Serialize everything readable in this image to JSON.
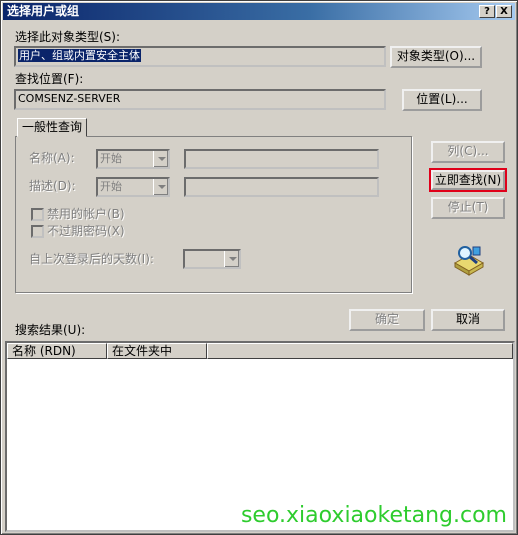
{
  "window": {
    "title": "选择用户或组",
    "help_button": "?",
    "close_button": "X"
  },
  "object_type": {
    "label": "选择此对象类型(S):",
    "value": "用户、组或内置安全主体",
    "button": "对象类型(O)..."
  },
  "location": {
    "label": "查找位置(F):",
    "value": "COMSENZ-SERVER",
    "button": "位置(L)..."
  },
  "query": {
    "tab_label": "一般性查询",
    "name_label": "名称(A):",
    "name_mode": "开始",
    "desc_label": "描述(D):",
    "desc_mode": "开始",
    "disabled_accounts": "禁用的帐户(B)",
    "non_expiring_pw": "不过期密码(X)",
    "days_label": "自上次登录后的天数(I):"
  },
  "actions": {
    "columns": "列(C)...",
    "find_now": "立即查找(N)",
    "stop": "停止(T)",
    "ok": "确定",
    "cancel": "取消"
  },
  "results": {
    "label": "搜索结果(U):",
    "columns": [
      "名称 (RDN)",
      "在文件夹中"
    ]
  },
  "watermark": "seo.xiaoxiaoketang.com",
  "colors": {
    "titlebar": "#0a246a",
    "find_now_highlight": "#e0001a",
    "watermark": "#2ecc2e"
  }
}
